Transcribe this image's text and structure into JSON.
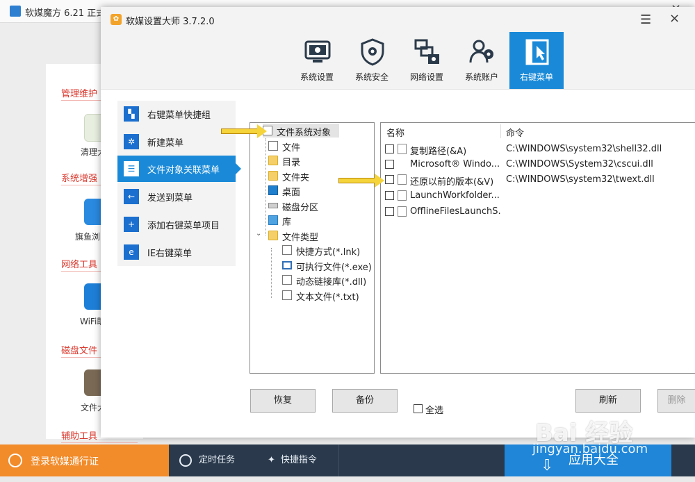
{
  "background_app": {
    "title": "软媒魔方 6.21 正式",
    "sections": [
      "管理维护",
      "系统增强",
      "网络工具",
      "磁盘文件",
      "辅助工具"
    ],
    "tiles": [
      "清理大",
      "旗鱼浏",
      "WiFi助",
      "文件大"
    ],
    "bottom_bar": {
      "login": "登录软媒通行证",
      "timer": "定时任务",
      "shortcut": "快捷指令",
      "apps": "应用大全"
    }
  },
  "dialog": {
    "title": "软媒设置大师 3.7.2.0",
    "menu_icon": "☰",
    "close_icon": "×",
    "toolbar": [
      {
        "label": "系统设置",
        "icon": "settings-monitor-icon"
      },
      {
        "label": "系统安全",
        "icon": "shield-gear-icon"
      },
      {
        "label": "网络设置",
        "icon": "network-icon"
      },
      {
        "label": "系统账户",
        "icon": "users-icon"
      },
      {
        "label": "右键菜单",
        "icon": "cursor-icon",
        "active": true
      }
    ],
    "left_nav": [
      {
        "label": "右键菜单快捷组",
        "icon": "▚"
      },
      {
        "label": "新建菜单",
        "icon": "✲"
      },
      {
        "label": "文件对象关联菜单",
        "icon": "☰",
        "active": true
      },
      {
        "label": "发送到菜单",
        "icon": "←"
      },
      {
        "label": "添加右键菜单项目",
        "icon": "+"
      },
      {
        "label": "IE右键菜单",
        "icon": "e"
      }
    ],
    "tree": [
      {
        "label": "文件系统对象",
        "icon": "doc",
        "selected": true
      },
      {
        "label": "文件",
        "icon": "doc"
      },
      {
        "label": "目录",
        "icon": "folder"
      },
      {
        "label": "文件夹",
        "icon": "folder"
      },
      {
        "label": "桌面",
        "icon": "monitor"
      },
      {
        "label": "磁盘分区",
        "icon": "disk"
      },
      {
        "label": "库",
        "icon": "lib"
      },
      {
        "label": "文件类型",
        "icon": "folder",
        "expanded": true
      },
      {
        "label": "快捷方式(*.lnk)",
        "icon": "lnk"
      },
      {
        "label": "可执行文件(*.exe)",
        "icon": "exe"
      },
      {
        "label": "动态链接库(*.dll)",
        "icon": "lnk"
      },
      {
        "label": "文本文件(*.txt)",
        "icon": "doc"
      }
    ],
    "list": {
      "columns": [
        "名称",
        "命令"
      ],
      "rows": [
        {
          "name": "复制路径(&A)",
          "command": "C:\\WINDOWS\\system32\\shell32.dll",
          "checked": false
        },
        {
          "name": "Microsoft® Windo...",
          "command": "C:\\WINDOWS\\System32\\cscui.dll",
          "checked": false
        },
        {
          "name": "还原以前的版本(&V)",
          "command": "C:\\WINDOWS\\system32\\twext.dll",
          "checked": false
        },
        {
          "name": "LaunchWorkfolder...",
          "command": "",
          "checked": false
        },
        {
          "name": "OfflineFilesLaunchS...",
          "command": "",
          "checked": false
        }
      ]
    },
    "buttons": {
      "restore": "恢复",
      "backup": "备份",
      "select_all": "全选",
      "refresh": "刷新",
      "delete": "删除"
    }
  },
  "watermark": {
    "main": "Bai 经验",
    "url": "jingyan.baidu.com"
  }
}
